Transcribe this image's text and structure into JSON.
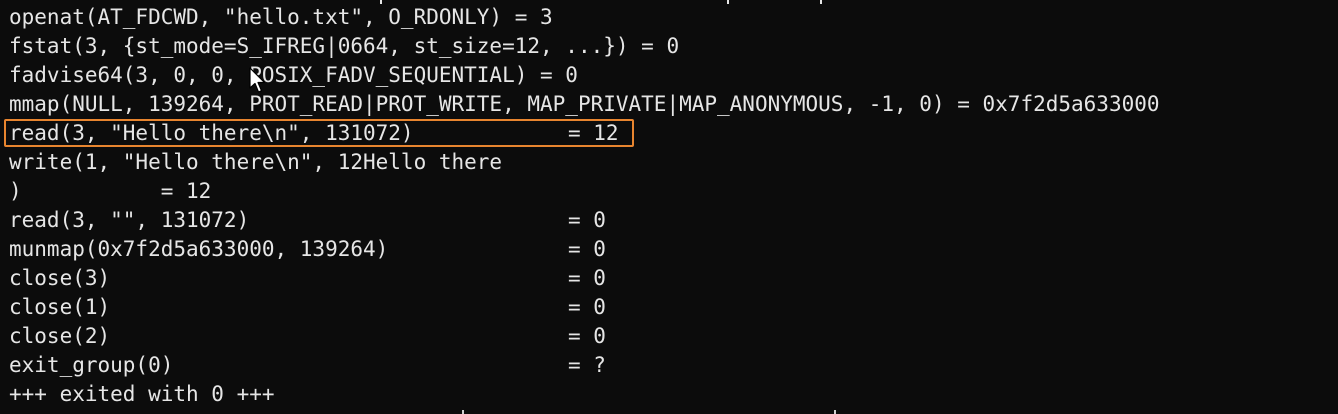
{
  "terminal": {
    "lines": [
      {
        "call": "openat(AT_FDCWD, \"hello.txt\", O_RDONLY) = 3",
        "ret": ""
      },
      {
        "call": "fstat(3, {st_mode=S_IFREG|0664, st_size=12, ...}) = 0",
        "ret": ""
      },
      {
        "call": "fadvise64(3, 0, 0, POSIX_FADV_SEQUENTIAL) = 0",
        "ret": ""
      },
      {
        "call": "mmap(NULL, 139264, PROT_READ|PROT_WRITE, MAP_PRIVATE|MAP_ANONYMOUS, -1, 0) = 0x7f2d5a633000",
        "ret": ""
      },
      {
        "call": "read(3, \"Hello there\\n\", 131072)",
        "ret": "= 12"
      },
      {
        "call": "write(1, \"Hello there\\n\", 12Hello there",
        "ret": ""
      },
      {
        "call": ")           = 12",
        "ret": ""
      },
      {
        "call": "read(3, \"\", 131072)",
        "ret": "= 0"
      },
      {
        "call": "munmap(0x7f2d5a633000, 139264)",
        "ret": "= 0"
      },
      {
        "call": "close(3)",
        "ret": "= 0"
      },
      {
        "call": "close(1)",
        "ret": "= 0"
      },
      {
        "call": "close(2)",
        "ret": "= 0"
      },
      {
        "call": "exit_group(0)",
        "ret": "= ?"
      },
      {
        "call": "+++ exited with 0 +++",
        "ret": ""
      }
    ],
    "highlighted_line_index": 4,
    "highlight_color": "#e8852f",
    "background_color": "#0c0c0c",
    "text_color": "#e6e6e6",
    "pointer_icon": "mouse-pointer-icon"
  }
}
